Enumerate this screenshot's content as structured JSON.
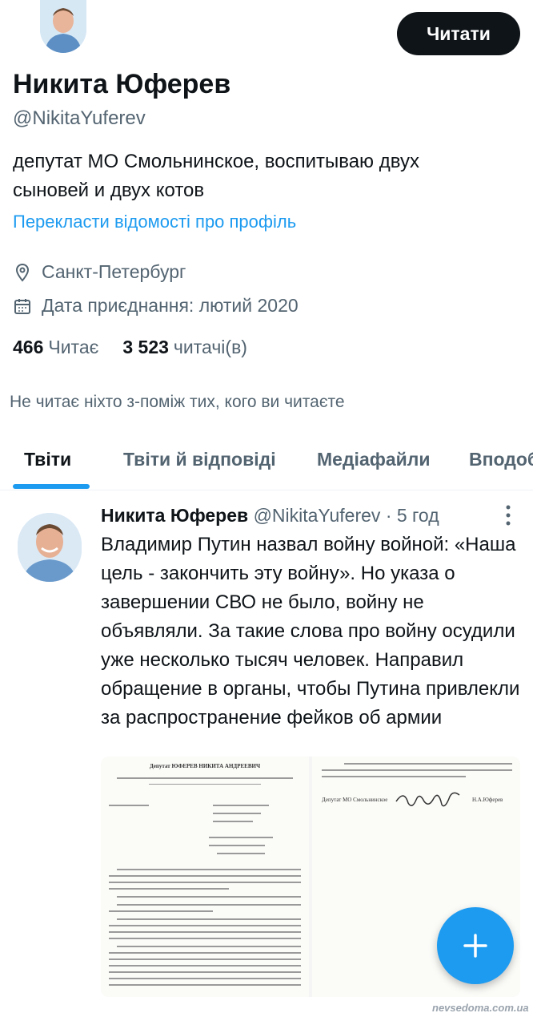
{
  "header": {
    "follow_label": "Читати"
  },
  "profile": {
    "name": "Никита Юферев",
    "handle": "@NikitaYuferev",
    "bio": "депутат МО Смольнинское, воспитываю двух сыновей и двух котов",
    "translate_label": "Перекласти відомості про профіль",
    "location": "Санкт-Петербург",
    "joined": "Дата приєднання: лютий 2020",
    "following_count": "466",
    "following_label": "Читає",
    "followers_count": "3 523",
    "followers_label": "читачі(в)",
    "mutual_note": "Не читає ніхто з-поміж тих, кого ви читаєте"
  },
  "tabs": [
    {
      "label": "Твіти",
      "active": true
    },
    {
      "label": "Твіти й відповіді",
      "active": false
    },
    {
      "label": "Медіафайли",
      "active": false
    },
    {
      "label": "Вподобання",
      "active": false
    }
  ],
  "tweet": {
    "author": "Никита Юферев",
    "handle": "@NikitaYuferev",
    "time": "· 5 год",
    "text": "Владимир Путин назвал войну войной: «Наша цель - закончить эту войну». Но указа о завершении СВО не было, войну не объявляли. За такие слова про войну осудили уже несколько тысяч человек. Направил обращение в органы, чтобы Путина  привлекли за распространение фейков об армии",
    "doc_title": "Депутат ЮФЕРЕВ НИКИТА АНДРЕЕВИЧ",
    "doc_sign": "Депутат МО Смольнинское",
    "doc_signer": "Н.А.Юферев"
  },
  "icons": {
    "location": "location-pin-icon",
    "calendar": "calendar-icon",
    "more": "more-vertical-icon",
    "compose": "plus-icon"
  },
  "colors": {
    "accent": "#1d9bf0",
    "text": "#0f1419",
    "muted": "#536471"
  },
  "watermark": "nevsedoma.com.ua"
}
